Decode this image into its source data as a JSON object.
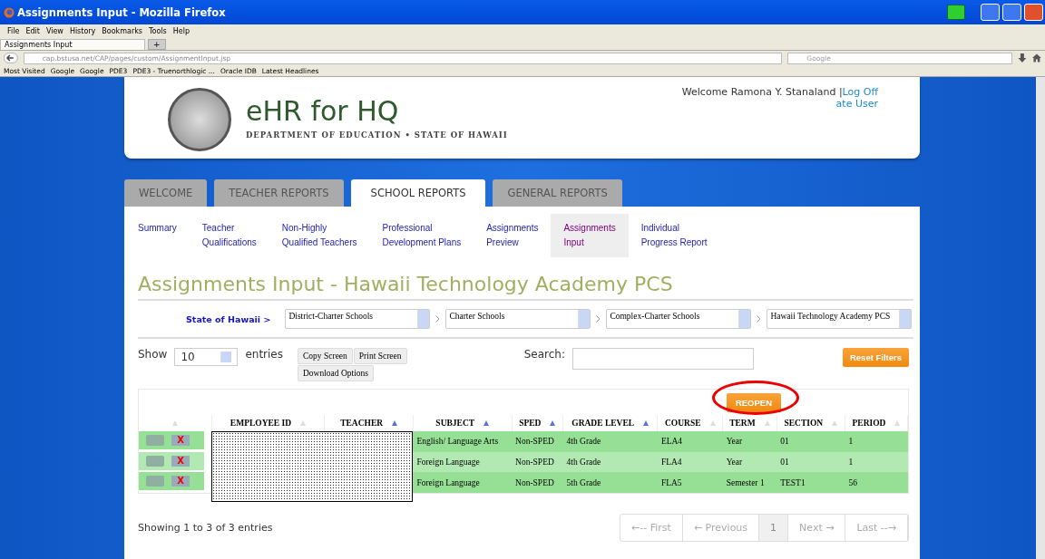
{
  "window": {
    "title": "Assignments Input - Mozilla Firefox"
  },
  "menu": [
    "File",
    "Edit",
    "View",
    "History",
    "Bookmarks",
    "Tools",
    "Help"
  ],
  "browser_tabs": [
    {
      "label": "Assignments Input",
      "selected": true
    }
  ],
  "new_tab": "+",
  "address_bar": {
    "url": "cap.bstusa.net/CAP/pages/custom/AssignmentInput.jsp"
  },
  "search_bar": {
    "placeholder": "Google"
  },
  "bookmarks": [
    "Most Visited",
    "Google",
    "Google",
    "PDE3",
    "PDE3 - Truenorthlogic ...",
    "Oracle IDB",
    "Latest Headlines"
  ],
  "site": {
    "title": "eHR for HQ",
    "subtitle": "DEPARTMENT OF EDUCATION • STATE OF HAWAII",
    "welcome": "Welcome Ramona Y. Stanaland |",
    "logoff": "Log Off",
    "alternate": "ate User"
  },
  "tabs": [
    {
      "label": "WELCOME",
      "selected": false
    },
    {
      "label": "TEACHER REPORTS",
      "selected": false
    },
    {
      "label": "SCHOOL REPORTS",
      "selected": true
    },
    {
      "label": "GENERAL REPORTS",
      "selected": false
    }
  ],
  "subnav": [
    {
      "lines": [
        "Summary"
      ],
      "selected": false
    },
    {
      "lines": [
        "Teacher",
        "Qualifications"
      ],
      "selected": false
    },
    {
      "lines": [
        "Non-Highly",
        "Qualified Teachers"
      ],
      "selected": false
    },
    {
      "lines": [
        "Professional",
        "Development Plans"
      ],
      "selected": false
    },
    {
      "lines": [
        "Assignments",
        "Preview"
      ],
      "selected": false
    },
    {
      "lines": [
        "Assignments",
        "Input"
      ],
      "selected": true
    },
    {
      "lines": [
        "Individual",
        "Progress Report"
      ],
      "selected": false
    }
  ],
  "page_title": "Assignments Input - Hawaii Technology Academy PCS",
  "breadcrumb": {
    "root": "State of Hawaii >",
    "selects": [
      "District-Charter Schools",
      "Charter Schools",
      "Complex-Charter Schools",
      "Hawaii Technology Academy PCS"
    ]
  },
  "length": {
    "before": "Show",
    "value": "10",
    "after": "entries"
  },
  "export_buttons": [
    "Copy Screen",
    "Print Screen",
    "Download Options"
  ],
  "search": {
    "label": "Search:"
  },
  "reset_button": "Reset Filters",
  "reopen_button": "REOPEN",
  "table": {
    "columns": [
      {
        "sorted": false
      },
      {
        "label": "EMPLOYEE ID",
        "sorted": false
      },
      {
        "label": "TEACHER",
        "sorted": true
      },
      {
        "label": "SUBJECT",
        "sorted": true
      },
      {
        "label": "SPED",
        "sorted": true
      },
      {
        "label": "GRADE LEVEL",
        "sorted": true
      },
      {
        "label": "COURSE",
        "sorted": false
      },
      {
        "label": "TERM",
        "sorted": false
      },
      {
        "label": "SECTION",
        "sorted": false
      },
      {
        "label": "PERIOD",
        "sorted": false
      }
    ],
    "rows": [
      {
        "delete_mark": "X",
        "cells": [
          "",
          "",
          "",
          "English/ Language Arts",
          "Non-SPED",
          "4th Grade",
          "ELA4",
          "Year",
          "01",
          "1"
        ]
      },
      {
        "delete_mark": "X",
        "cells": [
          "",
          "",
          "",
          "Foreign Language",
          "Non-SPED",
          "4th Grade",
          "FLA4",
          "Year",
          "01",
          "1"
        ]
      },
      {
        "delete_mark": "X",
        "cells": [
          "",
          "",
          "",
          "Foreign Language",
          "Non-SPED",
          "5th Grade",
          "FLA5",
          "Semester 1",
          "TEST1",
          "56"
        ]
      }
    ]
  },
  "info": "Showing 1 to 3 of 3 entries",
  "pagination": [
    {
      "label": "←-- First",
      "disabled": true,
      "selected": false
    },
    {
      "label": "← Previous",
      "disabled": true,
      "selected": false
    },
    {
      "label": "1",
      "disabled": false,
      "selected": true
    },
    {
      "label": "Next →",
      "disabled": true,
      "selected": false
    },
    {
      "label": "Last --→",
      "disabled": true,
      "selected": false
    }
  ]
}
